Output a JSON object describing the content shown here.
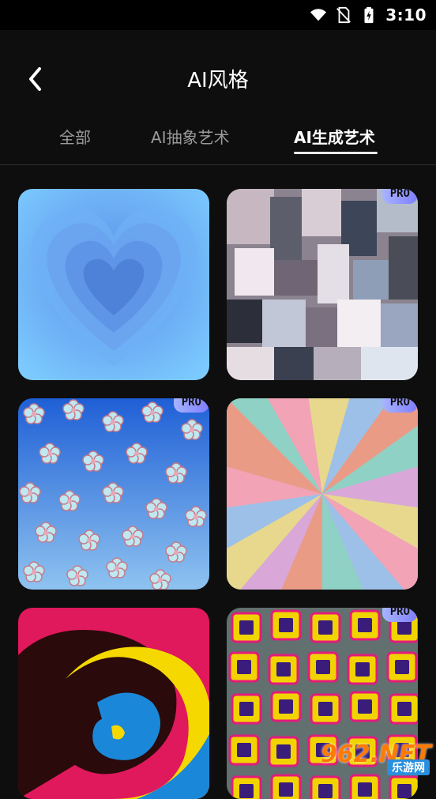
{
  "status_bar": {
    "time": "3:10",
    "icons": [
      "wifi-icon",
      "no-sim-icon",
      "battery-charging-icon"
    ]
  },
  "header": {
    "title": "AI风格",
    "back_icon": "chevron-left-icon"
  },
  "tabs": [
    {
      "label": "全部",
      "active": false
    },
    {
      "label": "AI抽象艺术",
      "active": false
    },
    {
      "label": "AI生成艺术",
      "active": true
    }
  ],
  "cards": [
    {
      "art": "blue-heart",
      "pro": false
    },
    {
      "art": "metallic-shards",
      "pro": true,
      "badge": "PRO"
    },
    {
      "art": "blue-flowers",
      "pro": true,
      "badge": "PRO"
    },
    {
      "art": "pastel-burst",
      "pro": true,
      "badge": "PRO"
    },
    {
      "art": "ink-swirl",
      "pro": false
    },
    {
      "art": "neon-tiles",
      "pro": true,
      "badge": "PRO"
    }
  ],
  "watermark": {
    "main": "962.NET",
    "sub": "乐游网"
  },
  "colors": {
    "background": "#0e0e0e",
    "tab_inactive": "#9a9a9a",
    "pro_badge": "#8f8fff"
  }
}
